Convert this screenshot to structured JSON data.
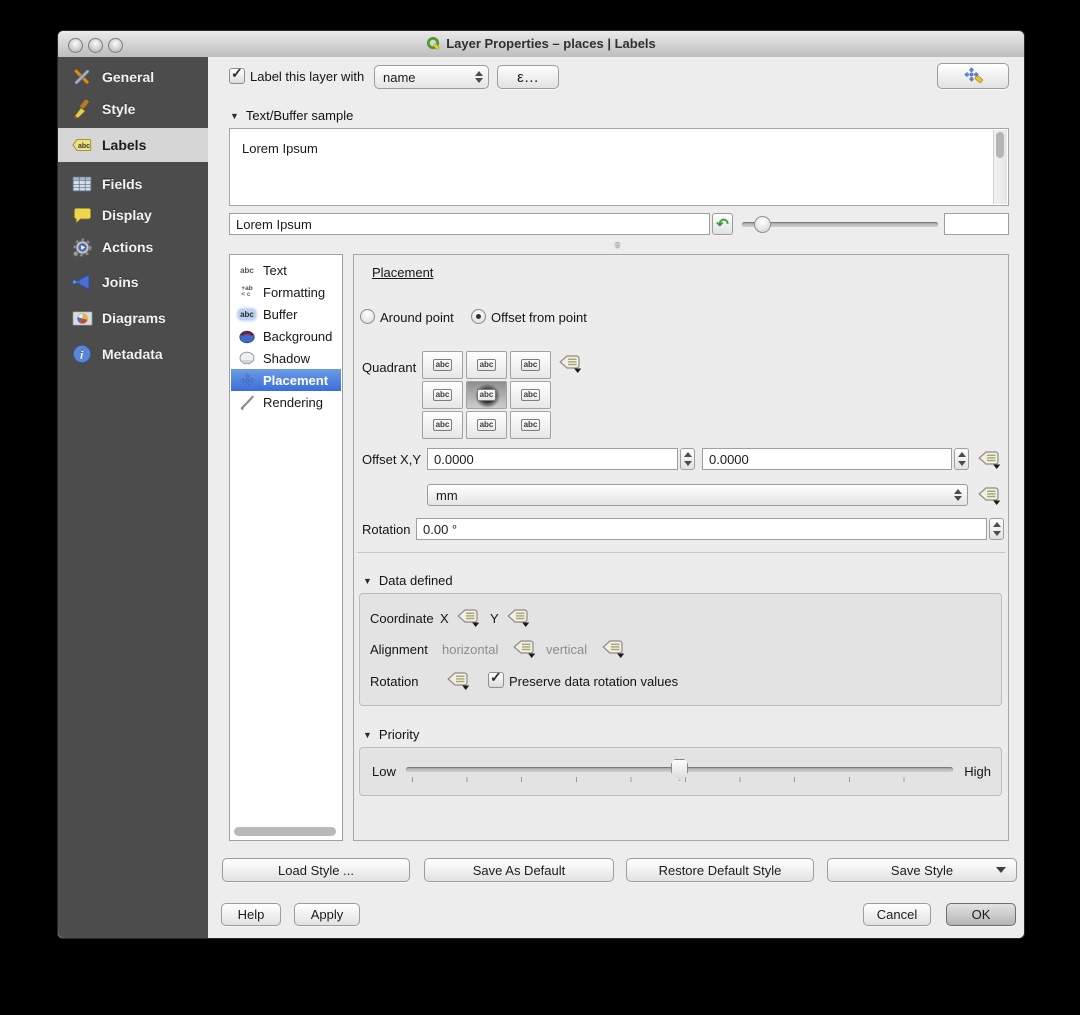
{
  "window": {
    "title": "Layer Properties – places | Labels"
  },
  "sidebar": {
    "items": [
      {
        "label": "General"
      },
      {
        "label": "Style"
      },
      {
        "label": "Labels",
        "selected": true
      },
      {
        "label": "Fields"
      },
      {
        "label": "Display"
      },
      {
        "label": "Actions"
      },
      {
        "label": "Joins"
      },
      {
        "label": "Diagrams"
      },
      {
        "label": "Metadata"
      }
    ]
  },
  "top": {
    "label_checkbox": "Label this layer with",
    "field_select": "name",
    "expression_button": "ε…"
  },
  "sample": {
    "section_title": "Text/Buffer sample",
    "preview_text": "Lorem Ipsum",
    "input_value": "Lorem Ipsum"
  },
  "tabs": {
    "items": [
      "Text",
      "Formatting",
      "Buffer",
      "Background",
      "Shadow",
      "Placement",
      "Rendering"
    ],
    "selected": "Placement"
  },
  "placement": {
    "title": "Placement",
    "radio_around": "Around point",
    "radio_offset": "Offset from point",
    "quadrant_label": "Quadrant",
    "offset_label": "Offset X,Y",
    "offset_x": "0.0000",
    "offset_y": "0.0000",
    "unit": "mm",
    "rotation_label": "Rotation",
    "rotation_value": "0.00 °"
  },
  "data_defined": {
    "section_title": "Data defined",
    "coordinate_label": "Coordinate",
    "x_label": "X",
    "y_label": "Y",
    "alignment_label": "Alignment",
    "horizontal_label": "horizontal",
    "vertical_label": "vertical",
    "rotation_label": "Rotation",
    "preserve_checkbox": "Preserve data rotation values"
  },
  "priority": {
    "section_title": "Priority",
    "low": "Low",
    "high": "High"
  },
  "style_buttons": {
    "load": "Load Style ...",
    "save_default": "Save As Default",
    "restore": "Restore Default Style",
    "save_style": "Save Style"
  },
  "bottom_buttons": {
    "help": "Help",
    "apply": "Apply",
    "cancel": "Cancel",
    "ok": "OK"
  },
  "icons": {
    "abc": "abc",
    "fmt_line1": "+ab",
    "fmt_line2": "< c",
    "undo": "↶",
    "section_triangle": "▼",
    "check": "✓"
  },
  "colors": {
    "selection_blue": "#3a6fd8",
    "sidebar_bg": "#4c4c4c",
    "sidebar_selected_bg": "#d6d6d6"
  }
}
